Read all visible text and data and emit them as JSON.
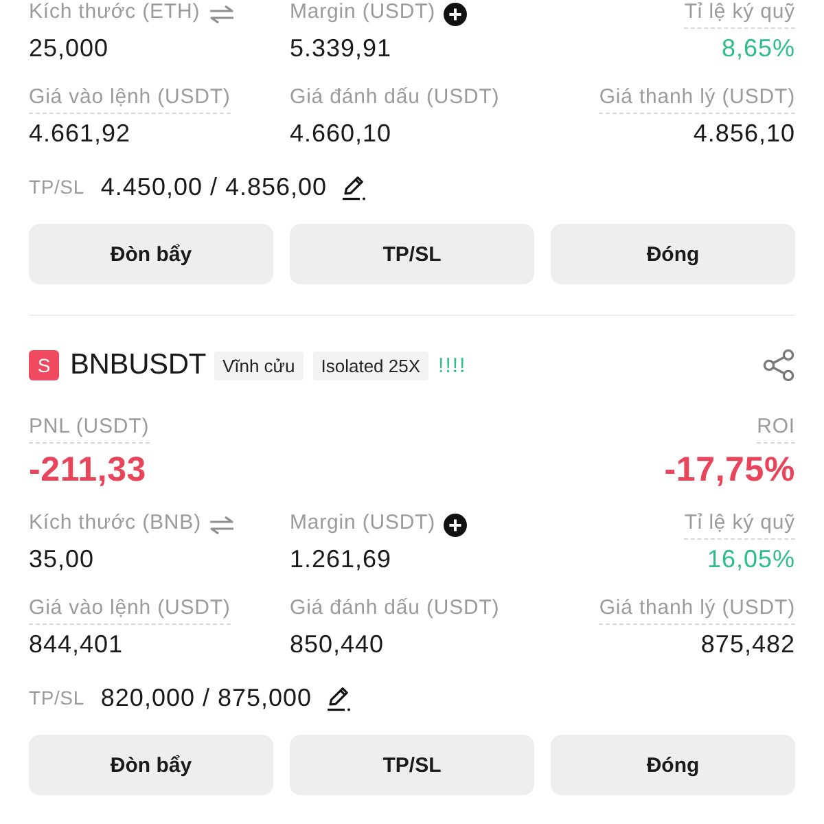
{
  "positions": [
    {
      "rows": [
        {
          "cells": [
            {
              "kind": "swap",
              "label": "Kích thước (ETH)",
              "value": "25,000",
              "underlined": false,
              "color": "#1a1a1a"
            },
            {
              "kind": "add",
              "label": "Margin (USDT)",
              "value": "5.339,91",
              "underlined": false,
              "color": "#1a1a1a"
            },
            {
              "kind": "plain",
              "label": "Tỉ lệ ký quỹ",
              "value": "8,65%",
              "underlined": true,
              "color": "#2fbd8c"
            }
          ]
        },
        {
          "cells": [
            {
              "kind": "plain",
              "label": "Giá vào lệnh (USDT)",
              "value": "4.661,92",
              "underlined": true,
              "color": "#1a1a1a"
            },
            {
              "kind": "plain",
              "label": "Giá đánh dấu (USDT)",
              "value": "4.660,10",
              "underlined": false,
              "color": "#1a1a1a"
            },
            {
              "kind": "plain",
              "label": "Giá thanh lý (USDT)",
              "value": "4.856,10",
              "underlined": true,
              "color": "#1a1a1a"
            }
          ]
        }
      ],
      "tpsl": {
        "label": "TP/SL",
        "value": "4.450,00 / 4.856,00"
      },
      "buttons": [
        "Đòn bẩy",
        "TP/SL",
        "Đóng"
      ]
    },
    {
      "header": {
        "side": "S",
        "symbol": "BNBUSDT",
        "tags": [
          "Vĩnh cửu",
          "Isolated 25X"
        ],
        "indicator": "!!!!"
      },
      "pnl": {
        "label": "PNL (USDT)",
        "value": "-211,33",
        "underlined": true,
        "color": "#e8455b"
      },
      "roi": {
        "label": "ROI",
        "value": "-17,75%",
        "underlined": true,
        "color": "#e8455b"
      },
      "rows": [
        {
          "cells": [
            {
              "kind": "swap",
              "label": "Kích thước (BNB)",
              "value": "35,00",
              "underlined": false,
              "color": "#1a1a1a"
            },
            {
              "kind": "add",
              "label": "Margin (USDT)",
              "value": "1.261,69",
              "underlined": false,
              "color": "#1a1a1a"
            },
            {
              "kind": "plain",
              "label": "Tỉ lệ ký quỹ",
              "value": "16,05%",
              "underlined": true,
              "color": "#2fbd8c"
            }
          ]
        },
        {
          "cells": [
            {
              "kind": "plain",
              "label": "Giá vào lệnh (USDT)",
              "value": "844,401",
              "underlined": true,
              "color": "#1a1a1a"
            },
            {
              "kind": "plain",
              "label": "Giá đánh dấu (USDT)",
              "value": "850,440",
              "underlined": false,
              "color": "#1a1a1a"
            },
            {
              "kind": "plain",
              "label": "Giá thanh lý (USDT)",
              "value": "875,482",
              "underlined": true,
              "color": "#1a1a1a"
            }
          ]
        }
      ],
      "tpsl": {
        "label": "TP/SL",
        "value": "820,000 / 875,000"
      },
      "buttons": [
        "Đòn bẩy",
        "TP/SL",
        "Đóng"
      ]
    }
  ]
}
